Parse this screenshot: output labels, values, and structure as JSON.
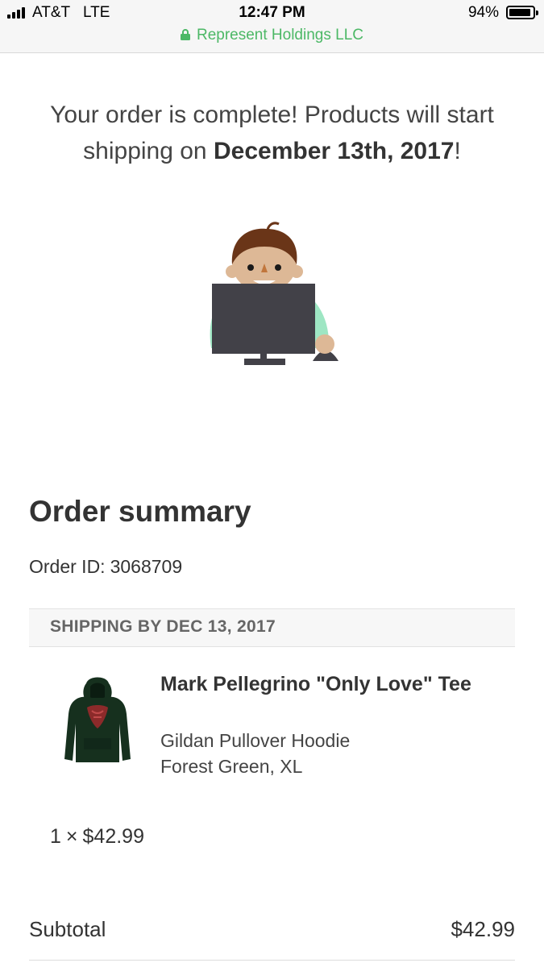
{
  "status_bar": {
    "carrier": "AT&T",
    "network": "LTE",
    "time": "12:47 PM",
    "battery": "94%",
    "battery_level": 0.94,
    "site": "Represent Holdings LLC"
  },
  "confirmation": {
    "message_prefix": "Your order is complete! Products will start shipping on",
    "ship_date": "December 13th, 2017",
    "message_suffix": "!"
  },
  "summary": {
    "title": "Order summary",
    "order_id_label": "Order ID:",
    "order_id": "3068709",
    "shipping_header": "SHIPPING BY DEC 13, 2017"
  },
  "item": {
    "name": "Mark Pellegrino \"Only Love\" Tee",
    "style": "Gildan Pullover Hoodie",
    "variant": "Forest Green, XL",
    "quantity": "1",
    "times": "×",
    "price": "$42.99",
    "image_icon": "hoodie-product-image"
  },
  "totals": {
    "subtotal_label": "Subtotal",
    "subtotal_value": "$42.99"
  },
  "colors": {
    "site_green": "#4cb866",
    "illustration_shirt": "#9ee6c3",
    "monitor": "#424148",
    "hair": "#6a3518",
    "skin": "#ddb896",
    "hoodie": "#16301e"
  }
}
